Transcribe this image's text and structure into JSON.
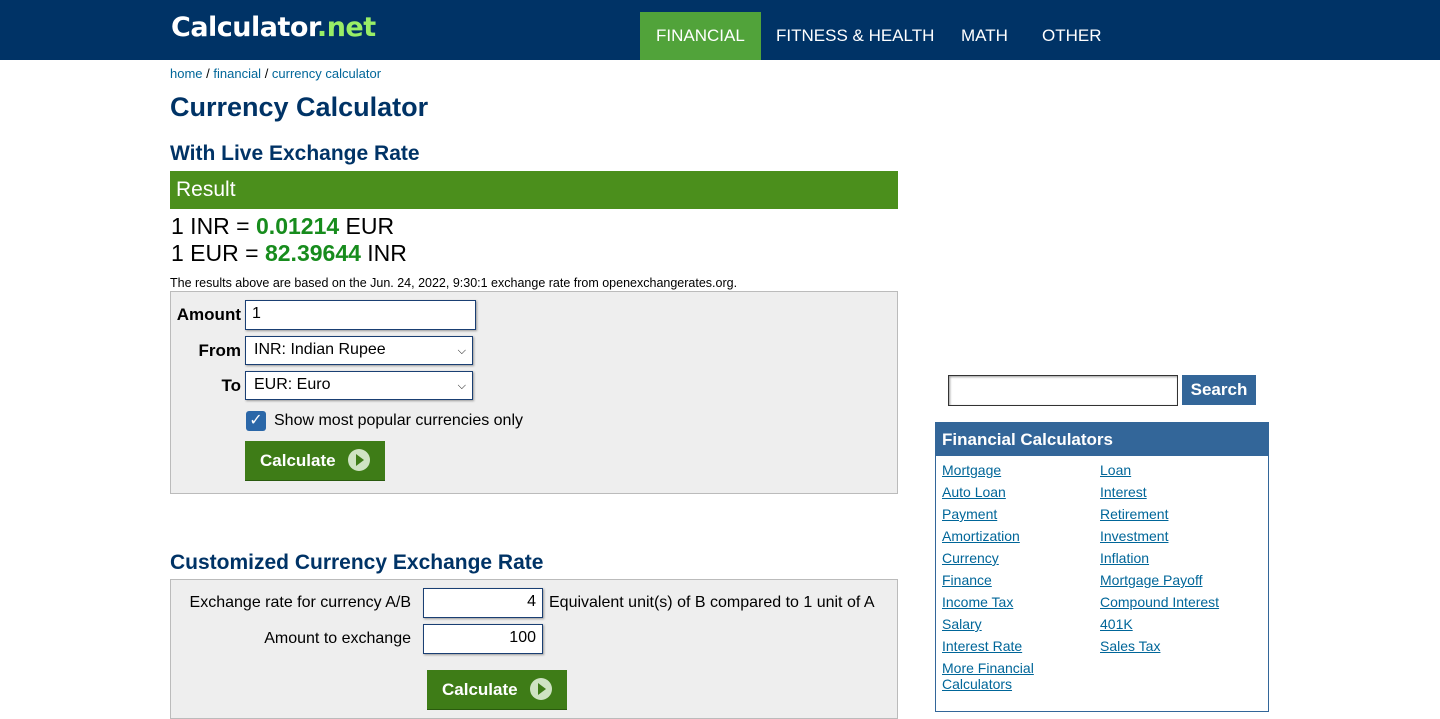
{
  "header": {
    "logo_main": "Calculator",
    "logo_dot": ".",
    "logo_net": "net",
    "nav": [
      "FINANCIAL",
      "FITNESS & HEALTH",
      "MATH",
      "OTHER"
    ],
    "active_nav": "FINANCIAL",
    "brand_color": "#003366",
    "active_color": "#51a33a"
  },
  "breadcrumb": {
    "items": [
      "home",
      "financial",
      "currency calculator"
    ],
    "separator": " / "
  },
  "page_title": "Currency Calculator",
  "live": {
    "subtitle": "With Live Exchange Rate",
    "result_label": "Result",
    "line1": {
      "prefix": "1 INR = ",
      "value": "0.01214",
      "suffix": " EUR"
    },
    "line2": {
      "prefix": "1 EUR = ",
      "value": "82.39644",
      "suffix": " INR"
    },
    "note": "The results above are based on the Jun. 24, 2022, 9:30:1 exchange rate from openexchangerates.org.",
    "form": {
      "amount_label": "Amount",
      "amount_value": "1",
      "from_label": "From",
      "from_value": "INR: Indian Rupee",
      "to_label": "To",
      "to_value": "EUR: Euro",
      "checkbox_label": "Show most popular currencies only",
      "checkbox_checked": true,
      "calculate_label": "Calculate"
    }
  },
  "custom": {
    "subtitle": "Customized Currency Exchange Rate",
    "rate_label": "Exchange rate for currency A/B",
    "rate_value": "4",
    "rate_suffix": "Equivalent unit(s) of B compared to 1 unit of A",
    "amount_label": "Amount to exchange",
    "amount_value": "100",
    "calculate_label": "Calculate"
  },
  "search": {
    "button_label": "Search",
    "value": ""
  },
  "sidebar": {
    "title": "Financial Calculators",
    "col1": [
      "Mortgage",
      "Auto Loan",
      "Payment",
      "Amortization",
      "Currency",
      "Finance",
      "Income Tax",
      "Salary",
      "Interest Rate",
      "More Financial",
      "Calculators"
    ],
    "col2": [
      "Loan",
      "Interest",
      "Retirement",
      "Investment",
      "Inflation",
      "Mortgage Payoff",
      "Compound Interest",
      "401K",
      "Sales Tax"
    ]
  }
}
